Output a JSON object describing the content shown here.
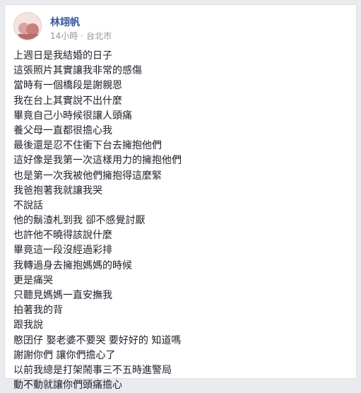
{
  "post": {
    "author": "林翊帆",
    "time": "14小時",
    "separator": "·",
    "location": "台北市",
    "lines": [
      "上週日是我結婚的日子",
      "這張照片其實讓我非常的感傷",
      "當時有一個橋段是謝親恩",
      "我在台上其實說不出什麼",
      "畢竟自己小時候很讓人頭痛",
      "養父母一直都很擔心我",
      "最後還是忍不住衝下台去擁抱他們",
      "這好像是我第一次這樣用力的擁抱他們",
      "也是第一次我被他們擁抱得這麼緊",
      "我爸抱著我就讓我哭",
      "不說話",
      "他的鬍渣札到我 卻不感覺討厭",
      "也許他不曉得該說什麼",
      "畢竟這一段沒經過彩排",
      "我轉過身去擁抱媽媽的時候",
      "更是痛哭",
      "只聽見媽媽一直安撫我",
      "拍著我的背",
      "跟我說",
      "憨囝仔 娶老婆不要哭 要好好的 知道嗎",
      "謝謝你們 讓你們擔心了",
      "以前我總是打架鬧事三不五時進警局",
      "動不動就讓你們頭痛擔心"
    ]
  },
  "icons": {
    "avatar": "profile-photo",
    "privacy": "globe-icon"
  },
  "colors": {
    "author": "#365899",
    "meta": "#90949c",
    "text": "#1d2129",
    "background": "#e9ebee"
  }
}
